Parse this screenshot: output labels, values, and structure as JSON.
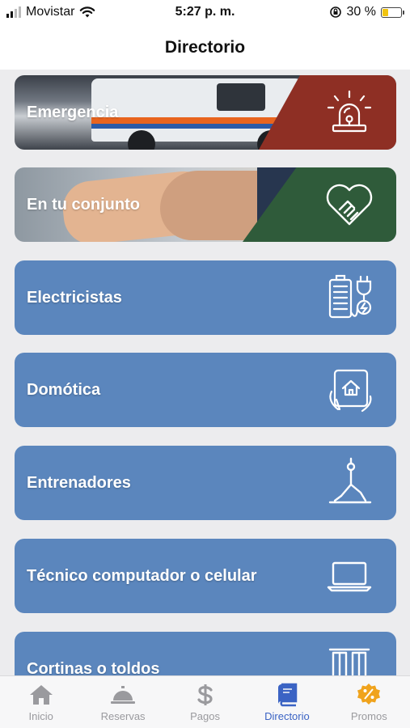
{
  "status_bar": {
    "carrier": "Movistar",
    "time": "5:27 p. m.",
    "battery_text": "30 %",
    "battery_level": 0.3,
    "icons": [
      "signal-icon",
      "wifi-icon",
      "rotation-lock-icon",
      "battery-icon"
    ]
  },
  "header": {
    "title": "Directorio"
  },
  "colors": {
    "card_blue": "#5b86bd",
    "emergency_red": "#8e2f24",
    "community_green": "#2f5b3a",
    "tab_active": "#3b63c4",
    "tab_inactive": "#9a9a9e",
    "promo_orange": "#f0a31c"
  },
  "directory": {
    "items": [
      {
        "label": "Emergencia",
        "icon": "siren-icon"
      },
      {
        "label": "En tu conjunto",
        "icon": "heart-handshake-icon"
      },
      {
        "label": "Electricistas",
        "icon": "battery-plug-icon"
      },
      {
        "label": "Domótica",
        "icon": "smart-home-tablet-icon"
      },
      {
        "label": "Entrenadores",
        "icon": "yoga-pose-icon"
      },
      {
        "label": "Técnico computador o celular",
        "icon": "laptop-icon"
      },
      {
        "label": "Cortinas o toldos",
        "icon": "curtains-icon"
      }
    ]
  },
  "tab_bar": {
    "active": "Directorio",
    "tabs": [
      {
        "label": "Inicio",
        "icon": "home-icon"
      },
      {
        "label": "Reservas",
        "icon": "service-bell-icon"
      },
      {
        "label": "Pagos",
        "icon": "dollar-icon"
      },
      {
        "label": "Directorio",
        "icon": "book-icon"
      },
      {
        "label": "Promos",
        "icon": "discount-badge-icon"
      }
    ]
  }
}
